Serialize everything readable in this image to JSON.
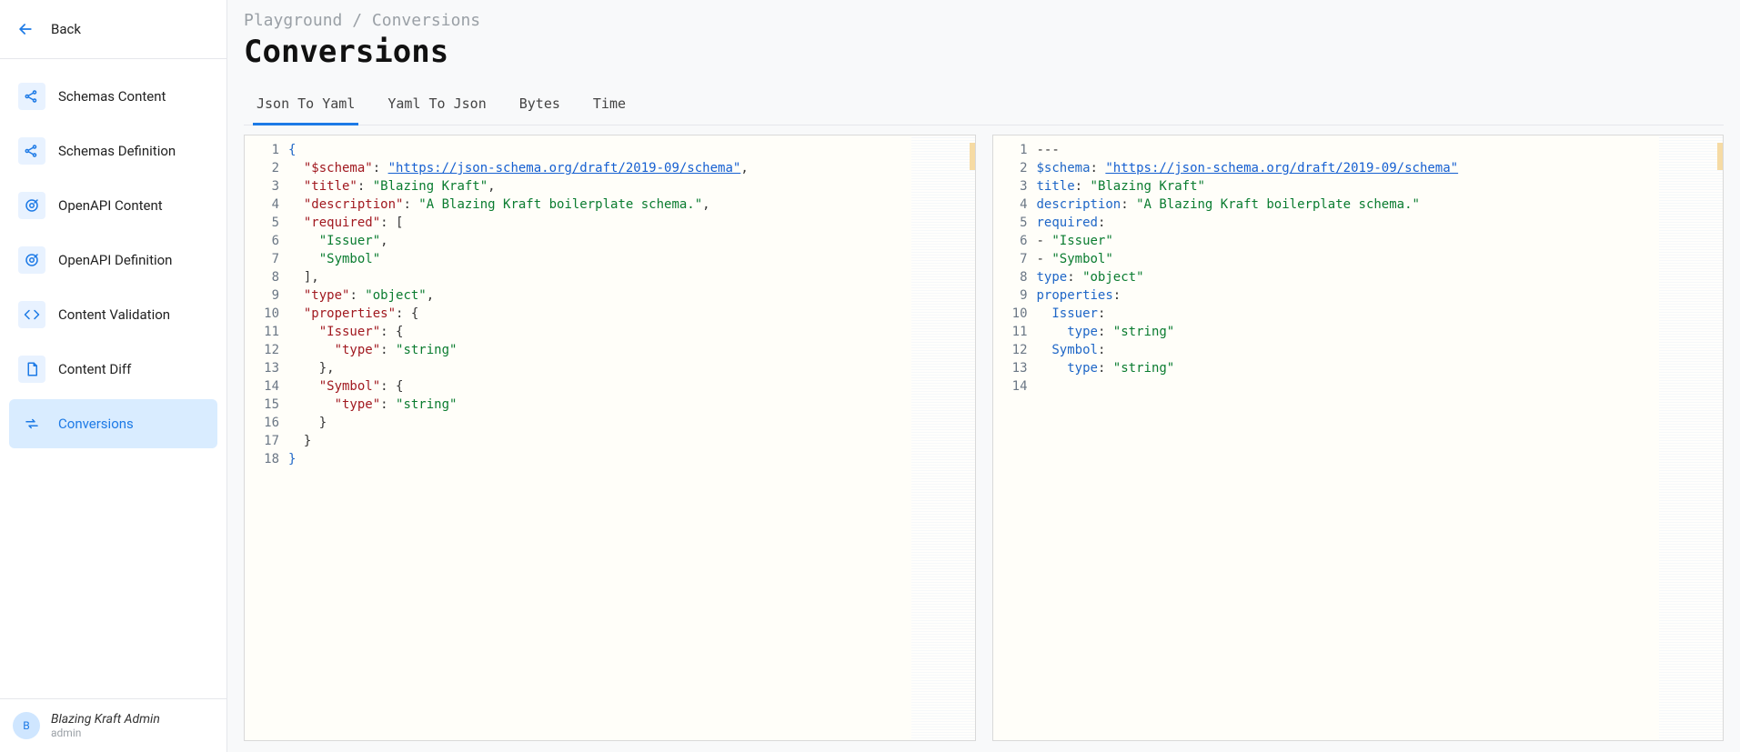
{
  "sidebar": {
    "back_label": "Back",
    "items": [
      {
        "id": "schemas-content",
        "label": "Schemas Content",
        "icon": "share-icon"
      },
      {
        "id": "schemas-definition",
        "label": "Schemas Definition",
        "icon": "share-icon"
      },
      {
        "id": "openapi-content",
        "label": "OpenAPI Content",
        "icon": "target-icon"
      },
      {
        "id": "openapi-definition",
        "label": "OpenAPI Definition",
        "icon": "target-icon"
      },
      {
        "id": "content-validation",
        "label": "Content Validation",
        "icon": "code-icon"
      },
      {
        "id": "content-diff",
        "label": "Content Diff",
        "icon": "doc-icon"
      },
      {
        "id": "conversions",
        "label": "Conversions",
        "icon": "swap-icon",
        "active": true
      }
    ]
  },
  "breadcrumb": [
    "Playground",
    "Conversions"
  ],
  "page_title": "Conversions",
  "tabs": [
    {
      "label": "Json To Yaml",
      "active": true
    },
    {
      "label": "Yaml To Json"
    },
    {
      "label": "Bytes"
    },
    {
      "label": "Time"
    }
  ],
  "left_editor": {
    "line_count": 18,
    "lines": [
      [
        {
          "t": "{",
          "c": "brace"
        }
      ],
      [
        {
          "t": "  ",
          "c": ""
        },
        {
          "t": "\"$schema\"",
          "c": "key"
        },
        {
          "t": ": ",
          "c": "punc"
        },
        {
          "t": "\"https://json-schema.org/draft/2019-09/schema\"",
          "c": "url"
        },
        {
          "t": ",",
          "c": "punc"
        }
      ],
      [
        {
          "t": "  ",
          "c": ""
        },
        {
          "t": "\"title\"",
          "c": "key"
        },
        {
          "t": ": ",
          "c": "punc"
        },
        {
          "t": "\"Blazing Kraft\"",
          "c": "str"
        },
        {
          "t": ",",
          "c": "punc"
        }
      ],
      [
        {
          "t": "  ",
          "c": ""
        },
        {
          "t": "\"description\"",
          "c": "key"
        },
        {
          "t": ": ",
          "c": "punc"
        },
        {
          "t": "\"A Blazing Kraft boilerplate schema.\"",
          "c": "str"
        },
        {
          "t": ",",
          "c": "punc"
        }
      ],
      [
        {
          "t": "  ",
          "c": ""
        },
        {
          "t": "\"required\"",
          "c": "key"
        },
        {
          "t": ": [",
          "c": "punc"
        }
      ],
      [
        {
          "t": "    ",
          "c": ""
        },
        {
          "t": "\"Issuer\"",
          "c": "str"
        },
        {
          "t": ",",
          "c": "punc"
        }
      ],
      [
        {
          "t": "    ",
          "c": ""
        },
        {
          "t": "\"Symbol\"",
          "c": "str"
        }
      ],
      [
        {
          "t": "  ",
          "c": ""
        },
        {
          "t": "],",
          "c": "punc"
        }
      ],
      [
        {
          "t": "  ",
          "c": ""
        },
        {
          "t": "\"type\"",
          "c": "key"
        },
        {
          "t": ": ",
          "c": "punc"
        },
        {
          "t": "\"object\"",
          "c": "str"
        },
        {
          "t": ",",
          "c": "punc"
        }
      ],
      [
        {
          "t": "  ",
          "c": ""
        },
        {
          "t": "\"properties\"",
          "c": "key"
        },
        {
          "t": ": {",
          "c": "punc"
        }
      ],
      [
        {
          "t": "    ",
          "c": ""
        },
        {
          "t": "\"Issuer\"",
          "c": "key"
        },
        {
          "t": ": {",
          "c": "punc"
        }
      ],
      [
        {
          "t": "      ",
          "c": ""
        },
        {
          "t": "\"type\"",
          "c": "key"
        },
        {
          "t": ": ",
          "c": "punc"
        },
        {
          "t": "\"string\"",
          "c": "str"
        }
      ],
      [
        {
          "t": "    ",
          "c": ""
        },
        {
          "t": "},",
          "c": "punc"
        }
      ],
      [
        {
          "t": "    ",
          "c": ""
        },
        {
          "t": "\"Symbol\"",
          "c": "key"
        },
        {
          "t": ": {",
          "c": "punc"
        }
      ],
      [
        {
          "t": "      ",
          "c": ""
        },
        {
          "t": "\"type\"",
          "c": "key"
        },
        {
          "t": ": ",
          "c": "punc"
        },
        {
          "t": "\"string\"",
          "c": "str"
        }
      ],
      [
        {
          "t": "    ",
          "c": ""
        },
        {
          "t": "}",
          "c": "punc"
        }
      ],
      [
        {
          "t": "  ",
          "c": ""
        },
        {
          "t": "}",
          "c": "punc"
        }
      ],
      [
        {
          "t": "}",
          "c": "brace"
        }
      ]
    ]
  },
  "right_editor": {
    "line_count": 14,
    "lines": [
      [
        {
          "t": "---",
          "c": "yp"
        }
      ],
      [
        {
          "t": "$schema",
          "c": "yk"
        },
        {
          "t": ": ",
          "c": "yp"
        },
        {
          "t": "\"https://json-schema.org/draft/2019-09/schema\"",
          "c": "url"
        }
      ],
      [
        {
          "t": "title",
          "c": "yk"
        },
        {
          "t": ": ",
          "c": "yp"
        },
        {
          "t": "\"Blazing Kraft\"",
          "c": "str"
        }
      ],
      [
        {
          "t": "description",
          "c": "yk"
        },
        {
          "t": ": ",
          "c": "yp"
        },
        {
          "t": "\"A Blazing Kraft boilerplate schema.\"",
          "c": "str"
        }
      ],
      [
        {
          "t": "required",
          "c": "yk"
        },
        {
          "t": ":",
          "c": "yp"
        }
      ],
      [
        {
          "t": "- ",
          "c": "yp"
        },
        {
          "t": "\"Issuer\"",
          "c": "str"
        }
      ],
      [
        {
          "t": "- ",
          "c": "yp"
        },
        {
          "t": "\"Symbol\"",
          "c": "str"
        }
      ],
      [
        {
          "t": "type",
          "c": "yk"
        },
        {
          "t": ": ",
          "c": "yp"
        },
        {
          "t": "\"object\"",
          "c": "str"
        }
      ],
      [
        {
          "t": "properties",
          "c": "yk"
        },
        {
          "t": ":",
          "c": "yp"
        }
      ],
      [
        {
          "t": "  ",
          "c": ""
        },
        {
          "t": "Issuer",
          "c": "yk"
        },
        {
          "t": ":",
          "c": "yp"
        }
      ],
      [
        {
          "t": "    ",
          "c": ""
        },
        {
          "t": "type",
          "c": "yk"
        },
        {
          "t": ": ",
          "c": "yp"
        },
        {
          "t": "\"string\"",
          "c": "str"
        }
      ],
      [
        {
          "t": "  ",
          "c": ""
        },
        {
          "t": "Symbol",
          "c": "yk"
        },
        {
          "t": ":",
          "c": "yp"
        }
      ],
      [
        {
          "t": "    ",
          "c": ""
        },
        {
          "t": "type",
          "c": "yk"
        },
        {
          "t": ": ",
          "c": "yp"
        },
        {
          "t": "\"string\"",
          "c": "str"
        }
      ],
      []
    ]
  },
  "user": {
    "name": "Blazing Kraft Admin",
    "sub": "admin",
    "initial": "B"
  }
}
